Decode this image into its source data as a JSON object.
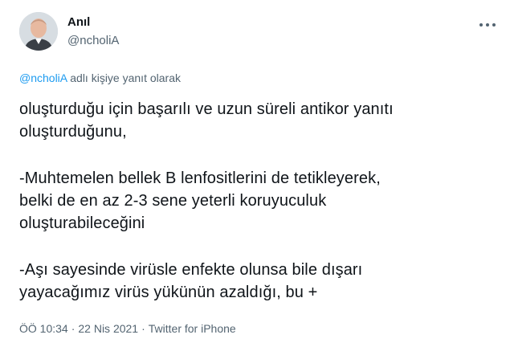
{
  "author": {
    "name": "Anıl",
    "handle": "@ncholiA",
    "avatar_icon": "person-avatar"
  },
  "more_icon": "more-horizontal-icon",
  "reply_context": {
    "mention": "@ncholiA",
    "text": " adlı kişiye yanıt olarak"
  },
  "body": {
    "p1": [
      "oluşturduğu için başarılı ve uzun süreli antikor yanıtı",
      "oluşturduğunu,"
    ],
    "p2": [
      "-Muhtemelen bellek B lenfositlerini de tetikleyerek,",
      "belki de en az 2-3 sene yeterli koruyuculuk",
      "oluşturabileceğini"
    ],
    "p3": [
      "-Aşı sayesinde virüsle enfekte olunsa bile dışarı",
      "yayacağımız virüs yükünün azaldığı, bu +"
    ]
  },
  "meta": {
    "time": "ÖÖ 10:34",
    "separator": "·",
    "date": "22 Nis 2021",
    "source": "Twitter for iPhone"
  },
  "colors": {
    "text": "#0f1419",
    "secondary": "#536471",
    "link": "#1d9bf0"
  }
}
